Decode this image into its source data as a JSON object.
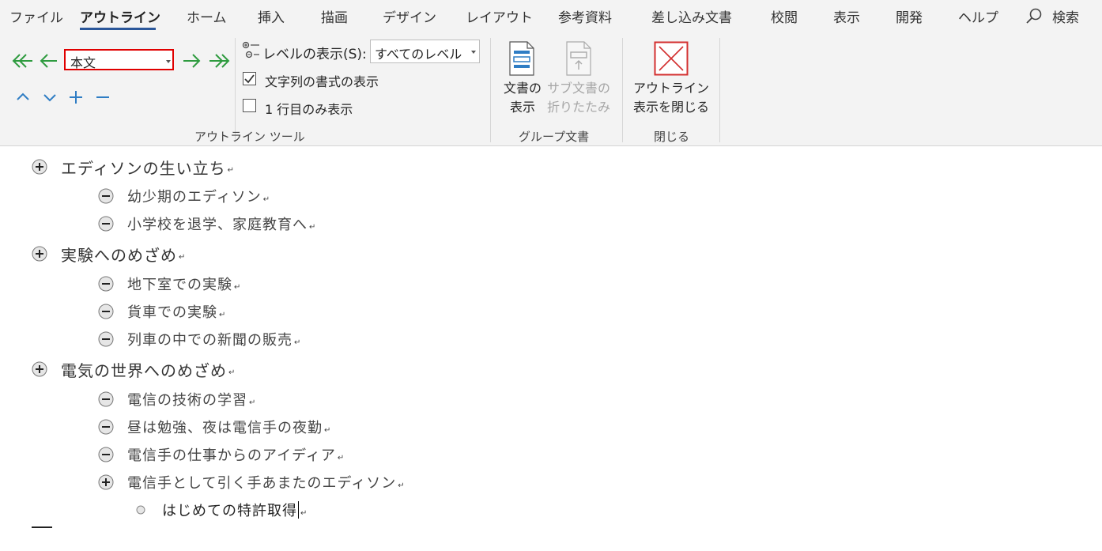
{
  "tabs": [
    {
      "label": "ファイル"
    },
    {
      "label": "アウトライン"
    },
    {
      "label": "ホーム"
    },
    {
      "label": "挿入"
    },
    {
      "label": "描画"
    },
    {
      "label": "デザイン"
    },
    {
      "label": "レイアウト"
    },
    {
      "label": "参考資料"
    },
    {
      "label": "差し込み文書"
    },
    {
      "label": "校閲"
    },
    {
      "label": "表示"
    },
    {
      "label": "開発"
    },
    {
      "label": "ヘルプ"
    }
  ],
  "active_tab": "アウトライン",
  "search": {
    "label": "検索",
    "icon": "search-icon"
  },
  "outline_tools": {
    "group_label": "アウトライン ツール",
    "level_value": "本文",
    "show_level_label": "レベルの表示(S):",
    "show_level_value": "すべてのレベル",
    "show_formatting": {
      "label": "文字列の書式の表示",
      "checked": true
    },
    "first_line_only": {
      "label": "1 行目のみ表示",
      "checked": false
    },
    "icons": [
      "promote-to-heading1-icon",
      "promote-icon",
      "demote-icon",
      "demote-to-body-icon",
      "move-up-icon",
      "move-down-icon",
      "expand-icon",
      "collapse-icon"
    ]
  },
  "master_document": {
    "group_label": "グループ文書",
    "show_document": {
      "line1": "文書の",
      "line2": "表示"
    },
    "collapse_subdocs": {
      "line1": "サブ文書の",
      "line2": "折りたたみ"
    }
  },
  "close_group": {
    "group_label": "閉じる",
    "close_outline": {
      "line1": "アウトライン",
      "line2": "表示を閉じる"
    }
  },
  "colors": {
    "accent": "#2b579a",
    "green_arrow": "#2e9b3f",
    "blue_arrow": "#2f7dc4",
    "highlight": "#e00000",
    "close_x": "#d32f2f"
  },
  "paragraph_mark": "↵",
  "outline": [
    {
      "level": 1,
      "symbol": "plus",
      "text": "エディソンの生い立ち"
    },
    {
      "level": 2,
      "symbol": "minus",
      "text": "幼少期のエディソン"
    },
    {
      "level": 2,
      "symbol": "minus",
      "text": "小学校を退学、家庭教育へ"
    },
    {
      "level": 1,
      "symbol": "plus",
      "text": "実験へのめざめ"
    },
    {
      "level": 2,
      "symbol": "minus",
      "text": "地下室での実験"
    },
    {
      "level": 2,
      "symbol": "minus",
      "text": "貨車での実験"
    },
    {
      "level": 2,
      "symbol": "minus",
      "text": "列車の中での新聞の販売"
    },
    {
      "level": 1,
      "symbol": "plus",
      "text": "電気の世界へのめざめ"
    },
    {
      "level": 2,
      "symbol": "minus",
      "text": "電信の技術の学習"
    },
    {
      "level": 2,
      "symbol": "minus",
      "text": "昼は勉強、夜は電信手の夜勤"
    },
    {
      "level": 2,
      "symbol": "minus",
      "text": "電信手の仕事からのアイディア"
    },
    {
      "level": 2,
      "symbol": "plus",
      "text": "電信手として引く手あまたのエディソン"
    },
    {
      "level": "body",
      "symbol": "bullet",
      "text": "はじめての特許取得"
    }
  ]
}
